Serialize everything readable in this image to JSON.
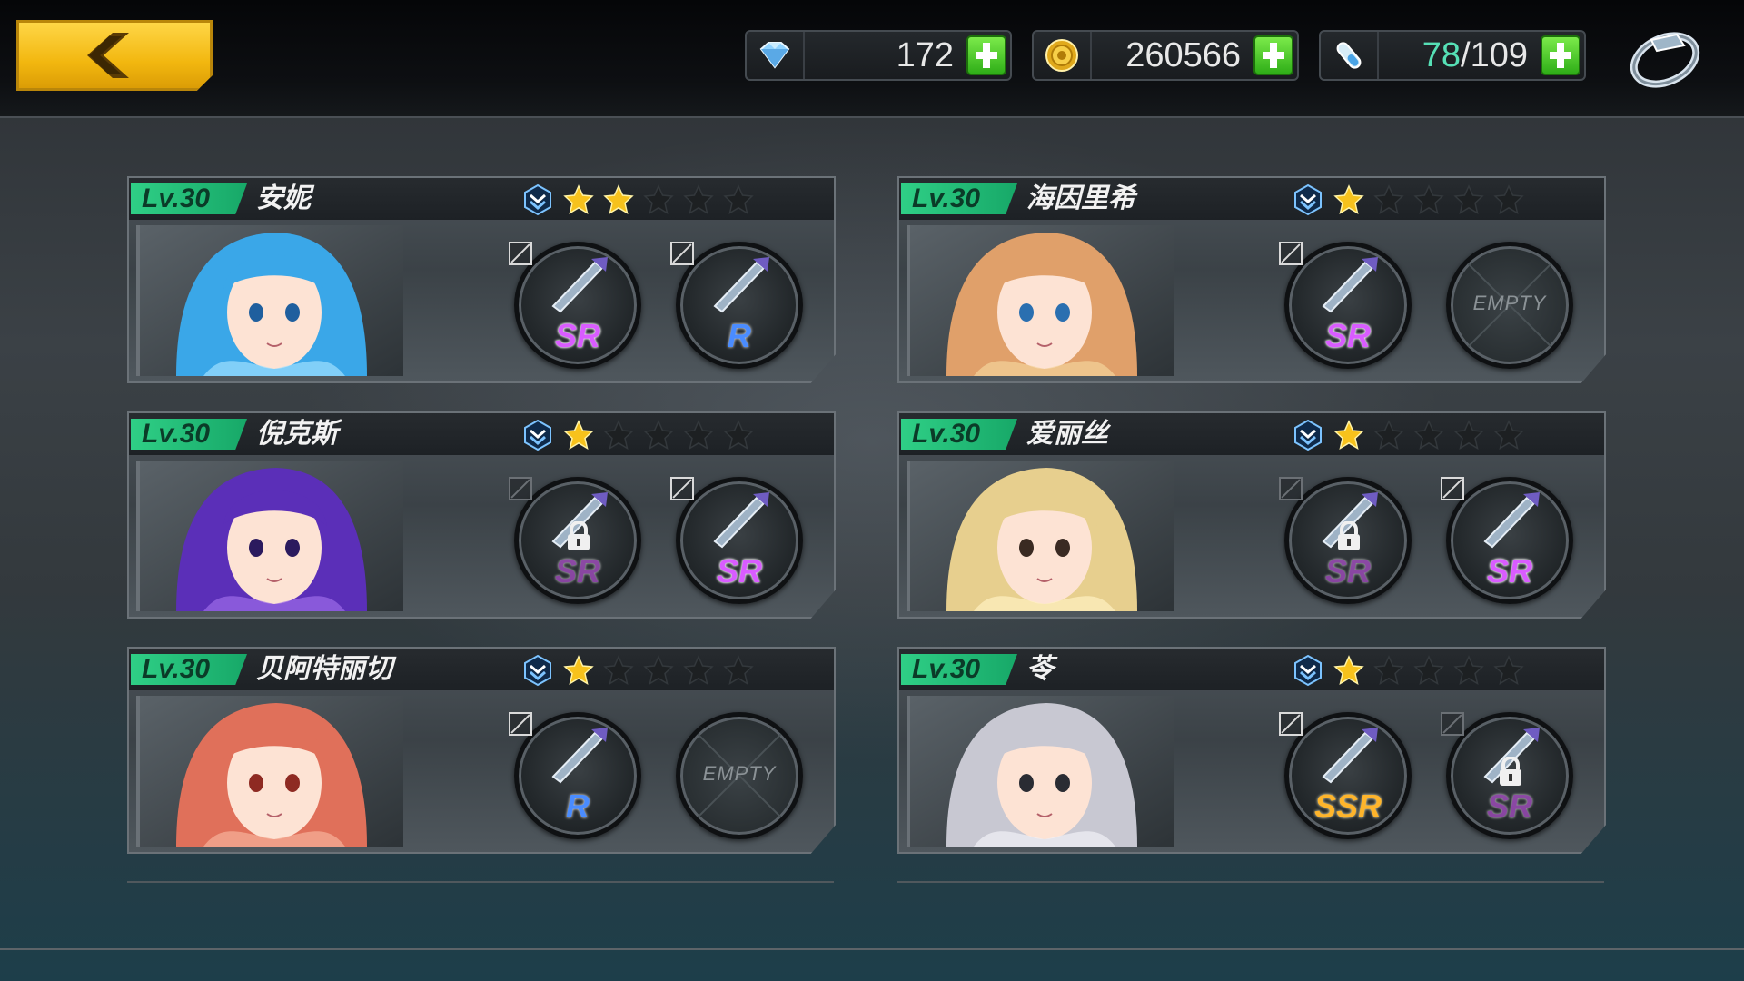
{
  "resources": {
    "gems": "172",
    "gold": "260566",
    "stamina_current": "78",
    "stamina_separator": "/",
    "stamina_max": "109"
  },
  "colors": {
    "level_badge": "#2fcf86",
    "star_filled": "#f7c21c",
    "star_empty": "#1d2022",
    "rarity_sr": "#d95cff",
    "rarity_r": "#4a8cff",
    "rarity_ssr": "#ffb52b",
    "back_button": "#f2b70f",
    "plus_button": "#2fae18"
  },
  "characters": [
    {
      "level": "Lv.30",
      "name": "安妮",
      "stars_filled": 2,
      "stars_total": 5,
      "slot1": {
        "rarity": "SR",
        "locked": false,
        "empty": false,
        "weapon_icon": "gun-icon"
      },
      "slot2": {
        "rarity": "R",
        "locked": false,
        "empty": false,
        "weapon_icon": "staff-icon"
      }
    },
    {
      "level": "Lv.30",
      "name": "海因里希",
      "stars_filled": 1,
      "stars_total": 5,
      "slot1": {
        "rarity": "SR",
        "locked": false,
        "empty": false,
        "weapon_icon": "dual-blades-icon"
      },
      "slot2": {
        "rarity": "",
        "locked": false,
        "empty": true,
        "empty_text": "EMPTY"
      }
    },
    {
      "level": "Lv.30",
      "name": "倪克斯",
      "stars_filled": 1,
      "stars_total": 5,
      "slot1": {
        "rarity": "SR",
        "locked": true,
        "empty": false,
        "weapon_icon": "dark-wing-icon"
      },
      "slot2": {
        "rarity": "SR",
        "locked": false,
        "empty": false,
        "weapon_icon": "orb-cannon-icon"
      }
    },
    {
      "level": "Lv.30",
      "name": "爱丽丝",
      "stars_filled": 1,
      "stars_total": 5,
      "slot1": {
        "rarity": "SR",
        "locked": true,
        "empty": false,
        "weapon_icon": "scythe-icon"
      },
      "slot2": {
        "rarity": "SR",
        "locked": false,
        "empty": false,
        "weapon_icon": "scythe-icon"
      }
    },
    {
      "level": "Lv.30",
      "name": "贝阿特丽切",
      "stars_filled": 1,
      "stars_total": 5,
      "slot1": {
        "rarity": "R",
        "locked": false,
        "empty": false,
        "weapon_icon": "rapier-icon"
      },
      "slot2": {
        "rarity": "",
        "locked": false,
        "empty": true,
        "empty_text": "EMPTY"
      }
    },
    {
      "level": "Lv.30",
      "name": "苓",
      "stars_filled": 1,
      "stars_total": 5,
      "slot1": {
        "rarity": "SSR",
        "locked": false,
        "empty": false,
        "weapon_icon": "twin-katana-icon"
      },
      "slot2": {
        "rarity": "SR",
        "locked": true,
        "empty": false,
        "weapon_icon": "dark-claw-icon"
      }
    }
  ]
}
